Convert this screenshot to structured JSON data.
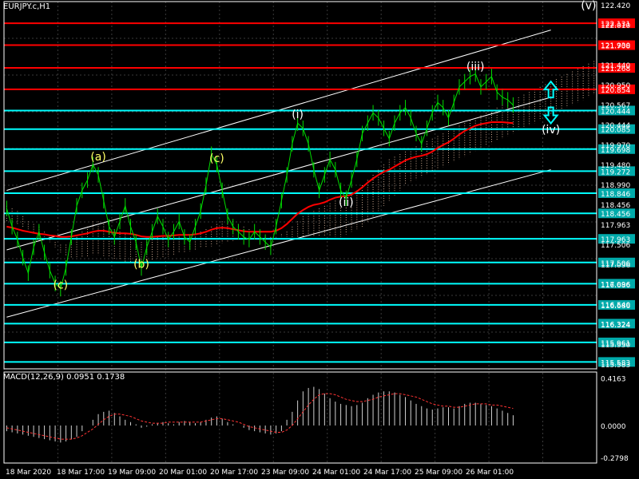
{
  "window": {
    "symbol": "EURJPY.c,H1"
  },
  "chart_data": {
    "type": "line",
    "symbol": "EURJPY.c",
    "timeframe": "H1",
    "price_axis": {
      "range": [
        115.45,
        122.55
      ],
      "ticks": [
        "122.420",
        "122.010",
        "121.930",
        "121.440",
        "120.950",
        "120.567",
        "120.444",
        "119.970",
        "119.480",
        "118.990",
        "118.456",
        "117.963",
        "117.506",
        "117.096",
        "116.686",
        "116.540",
        "116.324",
        "115.950",
        "115.583"
      ]
    },
    "time_axis": {
      "labels": [
        "18 Mar 2020",
        "18 Mar 17:00",
        "19 Mar 09:00",
        "20 Mar 01:00",
        "20 Mar 17:00",
        "23 Mar 09:00",
        "24 Mar 01:00",
        "24 Mar 17:00",
        "25 Mar 09:00",
        "26 Mar 01:00"
      ]
    },
    "red_levels": [
      {
        "price": 122.131,
        "label": "122.131"
      },
      {
        "price": 121.708,
        "label": "121.708"
      },
      {
        "price": 121.268,
        "label": "121.268"
      },
      {
        "price": 120.854,
        "label": "120.854"
      }
    ],
    "cyan_levels": [
      {
        "price": 120.444,
        "label": "120.444"
      },
      {
        "price": 120.085,
        "label": "120.085"
      },
      {
        "price": 119.698,
        "label": "119.698"
      },
      {
        "price": 119.272,
        "label": "119.272"
      },
      {
        "price": 118.846,
        "label": "118.846"
      },
      {
        "price": 118.456,
        "label": "118.456"
      },
      {
        "price": 117.963,
        "label": "117.963"
      },
      {
        "price": 117.506,
        "label": "117.506"
      },
      {
        "price": 117.096,
        "label": "117.096"
      },
      {
        "price": 116.686,
        "label": "116.686"
      },
      {
        "price": 116.324,
        "label": "116.324"
      },
      {
        "price": 115.961,
        "label": "115.961"
      },
      {
        "price": 115.583,
        "label": "115.583"
      }
    ],
    "current_price": "120.567",
    "wave_labels": [
      {
        "text": "(a)",
        "color": "#ffff66",
        "bar": 17,
        "price": 119.48
      },
      {
        "text": "(b)",
        "color": "#ffff66",
        "bar": 25,
        "price": 117.4
      },
      {
        "text": "(c)",
        "color": "#ffff66",
        "bar": 10,
        "price": 117.0
      },
      {
        "text": "(c)",
        "color": "#ffff66",
        "bar": 39,
        "price": 119.45
      },
      {
        "text": "(i)",
        "color": "#ffffff",
        "bar": 54,
        "price": 120.3
      },
      {
        "text": "(ii)",
        "color": "#ffffff",
        "bar": 63,
        "price": 118.6
      },
      {
        "text": "(iii)",
        "color": "#ffffff",
        "bar": 87,
        "price": 121.22
      },
      {
        "text": "(iv)",
        "color": "#ffffff",
        "bar": 101,
        "price": 120.0
      },
      {
        "text": "(v)",
        "color": "#ffffff",
        "bar": 108,
        "price": 122.4
      }
    ],
    "channel_lines": [
      {
        "from": [
          0,
          118.9
        ],
        "to": [
          101,
          122.0
        ]
      },
      {
        "from": [
          0,
          117.75
        ],
        "to": [
          101,
          120.7
        ]
      },
      {
        "from": [
          0,
          116.45
        ],
        "to": [
          101,
          119.3
        ]
      }
    ],
    "price_series": [
      [
        118.55,
        118.2,
        117.95,
        117.6,
        117.3,
        117.8,
        118.1,
        117.7,
        117.35,
        117.1,
        117.0,
        117.4,
        118.0,
        118.6,
        118.9,
        119.1,
        119.4,
        119.2,
        118.7,
        118.2,
        118.0,
        118.3,
        118.6,
        118.2,
        117.9,
        117.4,
        117.8,
        118.1,
        118.4,
        118.2,
        117.95,
        118.1,
        118.3,
        118.0,
        117.9,
        118.2,
        118.5,
        119.0,
        119.6,
        119.4,
        118.9,
        118.4,
        118.2,
        118.1,
        118.0,
        117.95,
        118.1,
        118.0,
        117.9,
        117.8,
        118.2,
        118.7,
        119.2,
        119.8,
        120.2,
        120.1,
        119.8,
        119.3,
        118.9,
        119.2,
        119.5,
        119.3,
        118.9,
        118.75,
        119.1,
        119.5,
        120.0,
        120.2,
        120.4,
        120.3,
        120.1,
        119.9,
        120.2,
        120.4,
        120.5,
        120.3,
        120.0,
        119.8,
        120.1,
        120.4,
        120.6,
        120.5,
        120.3,
        120.6,
        120.9,
        121.0,
        121.1,
        121.15,
        120.9,
        121.0,
        121.1,
        120.8,
        120.7,
        120.65,
        120.55
      ]
    ],
    "indicators": {
      "ma_red": [
        118.2,
        118.18,
        118.15,
        118.12,
        118.1,
        118.08,
        118.06,
        118.05,
        118.03,
        118.02,
        118.0,
        118.0,
        118.01,
        118.03,
        118.05,
        118.07,
        118.1,
        118.12,
        118.12,
        118.1,
        118.08,
        118.07,
        118.07,
        118.06,
        118.04,
        118.01,
        118.0,
        118.0,
        118.01,
        118.02,
        118.02,
        118.03,
        118.04,
        118.04,
        118.04,
        118.05,
        118.07,
        118.1,
        118.14,
        118.17,
        118.18,
        118.17,
        118.15,
        118.13,
        118.11,
        118.1,
        118.1,
        118.1,
        118.1,
        118.1,
        118.12,
        118.17,
        118.25,
        118.35,
        118.45,
        118.52,
        118.58,
        118.62,
        118.64,
        118.67,
        118.72,
        118.76,
        118.78,
        118.79,
        118.82,
        118.88,
        118.96,
        119.05,
        119.13,
        119.2,
        119.26,
        119.3,
        119.36,
        119.42,
        119.48,
        119.52,
        119.55,
        119.57,
        119.6,
        119.65,
        119.72,
        119.78,
        119.83,
        119.9,
        119.98,
        120.05,
        120.1,
        120.15,
        120.18,
        120.2,
        120.22,
        120.22,
        120.22,
        120.21,
        120.2
      ],
      "cloud_top": [
        118.6,
        118.55,
        118.5,
        118.4,
        118.3,
        118.25,
        118.2,
        118.1,
        118.0,
        117.9,
        117.85,
        117.85,
        117.9,
        118.0,
        118.1,
        118.2,
        118.3,
        118.3,
        118.25,
        118.2,
        118.15,
        118.1,
        118.05,
        118.0,
        117.95,
        117.9,
        117.9,
        117.95,
        118.0,
        118.0,
        118.0,
        118.0,
        118.05,
        118.05,
        118.05,
        118.05,
        118.1,
        118.15,
        118.2,
        118.25,
        118.3,
        118.3,
        118.3,
        118.25,
        118.2,
        118.15,
        118.1,
        118.05,
        118.0,
        118.0,
        118.0,
        118.05,
        118.1,
        118.2,
        118.3,
        118.4,
        118.45,
        118.5,
        118.55,
        118.6,
        118.65,
        118.7,
        118.75,
        118.8,
        118.85,
        118.9,
        119.0,
        119.1,
        119.2,
        119.3,
        119.4,
        119.5,
        119.55,
        119.6,
        119.65,
        119.7,
        119.75,
        119.8,
        119.85,
        119.9,
        119.95,
        120.0,
        120.05,
        120.1,
        120.15,
        120.2,
        120.25,
        120.3,
        120.35,
        120.4,
        120.45,
        120.5,
        120.55,
        120.6,
        120.65,
        120.7,
        120.75,
        120.8,
        120.85,
        120.9,
        120.95,
        121.0,
        121.05,
        121.1,
        121.15,
        121.2,
        121.25,
        121.3,
        121.35,
        121.4
      ],
      "cloud_bottom": [
        118.3,
        118.28,
        118.25,
        118.2,
        118.15,
        118.1,
        118.05,
        118.0,
        117.9,
        117.8,
        117.7,
        117.65,
        117.6,
        117.6,
        117.6,
        117.62,
        117.65,
        117.65,
        117.62,
        117.6,
        117.58,
        117.55,
        117.52,
        117.5,
        117.5,
        117.5,
        117.52,
        117.55,
        117.58,
        117.6,
        117.62,
        117.65,
        117.68,
        117.7,
        117.72,
        117.75,
        117.78,
        117.8,
        117.82,
        117.85,
        117.88,
        117.9,
        117.92,
        117.93,
        117.94,
        117.95,
        117.96,
        117.97,
        117.98,
        117.98,
        117.99,
        118.0,
        118.0,
        118.0,
        118.0,
        118.0,
        118.0,
        118.0,
        118.0,
        118.0,
        118.0,
        118.0,
        118.0,
        118.05,
        118.1,
        118.15,
        118.2,
        118.3,
        118.4,
        118.5,
        118.6,
        118.7,
        118.8,
        118.9,
        119.0,
        119.05,
        119.1,
        119.15,
        119.2,
        119.25,
        119.3,
        119.35,
        119.4,
        119.45,
        119.5,
        119.55,
        119.6,
        119.65,
        119.7,
        119.75,
        119.8,
        119.85,
        119.9,
        119.95,
        120.0,
        120.05,
        120.1,
        120.15,
        120.2,
        120.25,
        120.3,
        120.35,
        120.4,
        120.45,
        120.5,
        120.55,
        120.6,
        120.65,
        120.7,
        120.75
      ]
    },
    "macd": {
      "label": "MACD(12,26,9) 0.0951 0.1738",
      "range": [
        -0.33,
        0.47
      ],
      "ticks": [
        "0.4163",
        "0.0000",
        "-0.2798"
      ],
      "histogram": [
        -0.05,
        -0.06,
        -0.07,
        -0.08,
        -0.09,
        -0.1,
        -0.11,
        -0.12,
        -0.13,
        -0.14,
        -0.15,
        -0.14,
        -0.12,
        -0.1,
        -0.05,
        0.0,
        0.05,
        0.1,
        0.12,
        0.13,
        0.11,
        0.08,
        0.05,
        0.03,
        0.01,
        -0.02,
        -0.01,
        0.01,
        0.02,
        0.03,
        0.02,
        0.01,
        0.03,
        0.04,
        0.03,
        0.02,
        0.03,
        0.05,
        0.07,
        0.08,
        0.06,
        0.03,
        0.01,
        0.0,
        -0.02,
        -0.04,
        -0.05,
        -0.06,
        -0.07,
        -0.08,
        -0.07,
        -0.05,
        0.05,
        0.12,
        0.22,
        0.3,
        0.33,
        0.34,
        0.32,
        0.28,
        0.24,
        0.21,
        0.19,
        0.18,
        0.17,
        0.18,
        0.2,
        0.24,
        0.27,
        0.29,
        0.3,
        0.3,
        0.29,
        0.27,
        0.25,
        0.22,
        0.19,
        0.17,
        0.15,
        0.14,
        0.15,
        0.16,
        0.16,
        0.15,
        0.17,
        0.19,
        0.2,
        0.2,
        0.19,
        0.18,
        0.17,
        0.15,
        0.13,
        0.11,
        0.09
      ],
      "signal": [
        -0.02,
        -0.03,
        -0.04,
        -0.05,
        -0.06,
        -0.07,
        -0.08,
        -0.09,
        -0.1,
        -0.11,
        -0.12,
        -0.12,
        -0.12,
        -0.11,
        -0.09,
        -0.06,
        -0.03,
        0.01,
        0.05,
        0.08,
        0.1,
        0.1,
        0.09,
        0.08,
        0.06,
        0.04,
        0.03,
        0.02,
        0.02,
        0.02,
        0.03,
        0.03,
        0.03,
        0.03,
        0.03,
        0.03,
        0.03,
        0.04,
        0.05,
        0.06,
        0.06,
        0.05,
        0.04,
        0.03,
        0.01,
        -0.01,
        -0.02,
        -0.03,
        -0.04,
        -0.05,
        -0.06,
        -0.06,
        -0.04,
        0.0,
        0.06,
        0.12,
        0.18,
        0.23,
        0.27,
        0.28,
        0.28,
        0.27,
        0.25,
        0.23,
        0.22,
        0.21,
        0.21,
        0.22,
        0.23,
        0.25,
        0.26,
        0.27,
        0.28,
        0.28,
        0.27,
        0.26,
        0.25,
        0.23,
        0.21,
        0.19,
        0.18,
        0.17,
        0.17,
        0.16,
        0.16,
        0.17,
        0.18,
        0.19,
        0.19,
        0.19,
        0.18,
        0.18,
        0.17,
        0.16,
        0.15
      ]
    },
    "arrows": [
      {
        "direction": "up",
        "bar": 101,
        "price": 120.85
      },
      {
        "direction": "down",
        "bar": 101,
        "price": 120.35
      }
    ]
  }
}
